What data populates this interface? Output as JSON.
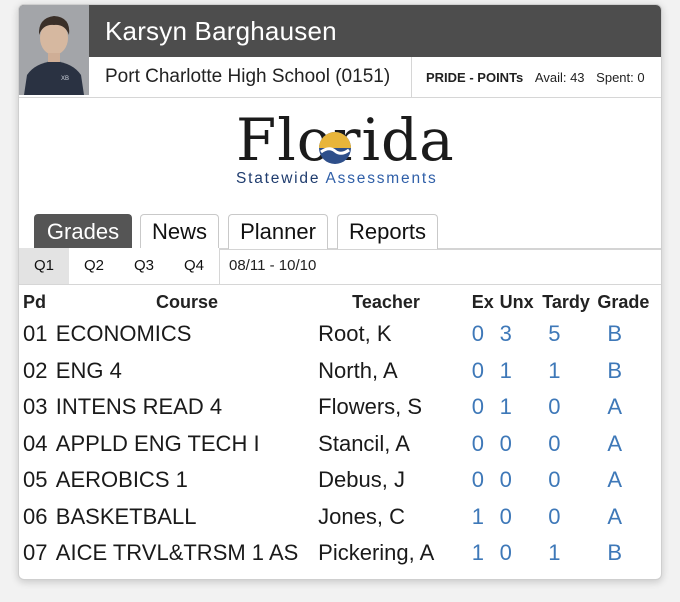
{
  "student": {
    "name": "Karsyn Barghausen",
    "school": "Port Charlotte High School (0151)"
  },
  "pride": {
    "label": "PRIDE - POINTs",
    "avail": "Avail: 43",
    "spent": "Spent: 0"
  },
  "logo": {
    "word": "Florida",
    "sub_part1": "Statewide",
    "sub_part2": "Assessments"
  },
  "tabs": [
    "Grades",
    "News",
    "Planner",
    "Reports"
  ],
  "quarters": [
    "Q1",
    "Q2",
    "Q3",
    "Q4"
  ],
  "date_range": "08/11 - 10/10",
  "table": {
    "headers": [
      "Pd",
      "Course",
      "Teacher",
      "Ex",
      "Unx",
      "Tardy",
      "Grade"
    ],
    "rows": [
      {
        "pd": "01",
        "course": "ECONOMICS",
        "teacher": "Root, K",
        "ex": "0",
        "unx": "3",
        "tardy": "5",
        "grade": "B"
      },
      {
        "pd": "02",
        "course": "ENG 4",
        "teacher": "North, A",
        "ex": "0",
        "unx": "1",
        "tardy": "1",
        "grade": "B"
      },
      {
        "pd": "03",
        "course": "INTENS READ 4",
        "teacher": "Flowers, S",
        "ex": "0",
        "unx": "1",
        "tardy": "0",
        "grade": "A"
      },
      {
        "pd": "04",
        "course": "APPLD ENG TECH I",
        "teacher": "Stancil, A",
        "ex": "0",
        "unx": "0",
        "tardy": "0",
        "grade": "A"
      },
      {
        "pd": "05",
        "course": "AEROBICS 1",
        "teacher": "Debus, J",
        "ex": "0",
        "unx": "0",
        "tardy": "0",
        "grade": "A"
      },
      {
        "pd": "06",
        "course": "BASKETBALL",
        "teacher": "Jones, C",
        "ex": "1",
        "unx": "0",
        "tardy": "0",
        "grade": "A"
      },
      {
        "pd": "07",
        "course": "AICE TRVL&TRSM 1 AS",
        "teacher": "Pickering, A",
        "ex": "1",
        "unx": "0",
        "tardy": "1",
        "grade": "B"
      }
    ]
  },
  "colors": {
    "header_bg": "#4d4d4d",
    "active_tab_bg": "#555555",
    "link_blue": "#3e78b8"
  }
}
